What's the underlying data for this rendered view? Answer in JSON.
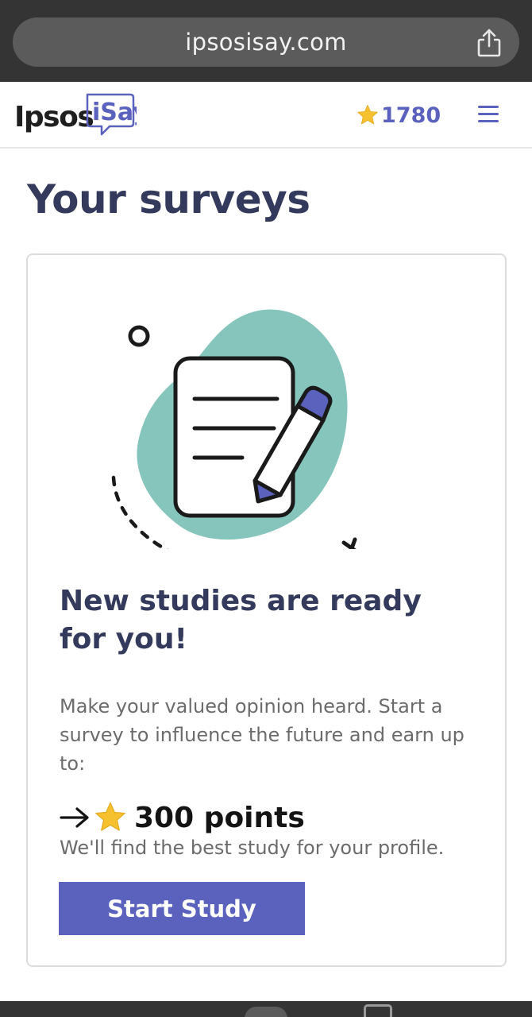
{
  "browser": {
    "url": "ipsosisay.com",
    "share_icon": "share-icon"
  },
  "header": {
    "logo_text": "Ipsos",
    "logo_badge": "iSay",
    "points": "1780",
    "points_icon": "star-icon",
    "menu_icon": "hamburger-menu-icon"
  },
  "page": {
    "title": "Your surveys"
  },
  "card": {
    "illustration_icon": "survey-document-pencil-illustration",
    "heading": "New studies are ready for you!",
    "body": "Make your valued opinion heard. Start a survey to influence the future and earn up to:",
    "reward_arrow_icon": "arrow-right-icon",
    "reward_star_icon": "star-icon",
    "reward": "300 points",
    "note": "We'll find the best study for your profile.",
    "button_label": "Start Study"
  },
  "colors": {
    "brand": "#5b62bd",
    "heading": "#343a5b",
    "teal_blob": "#86c5bc",
    "star": "#f5c12e"
  }
}
